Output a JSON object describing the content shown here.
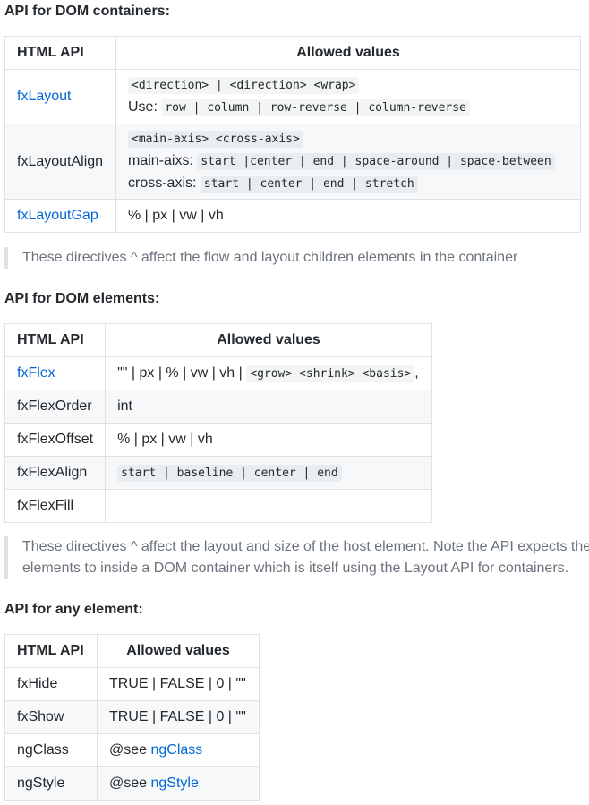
{
  "containers": {
    "title": "API for DOM containers:",
    "headers": [
      "HTML API",
      "Allowed values"
    ],
    "layout": {
      "name": "fxLayout",
      "code1": "<direction> | <direction> <wrap>",
      "use_label": "Use:",
      "code2": "row | column | row-reverse | column-reverse"
    },
    "layout_align": {
      "name": "fxLayoutAlign",
      "code1": "<main-axis> <cross-axis>",
      "main_label": "main-aixs:",
      "main_code": "start |center | end | space-around | space-between",
      "cross_label": "cross-axis:",
      "cross_code": "start | center | end | stretch"
    },
    "layout_gap": {
      "name": "fxLayoutGap",
      "value": "% | px | vw | vh"
    },
    "note": "These directives ^ affect the flow and layout children elements in the container"
  },
  "elements": {
    "title": "API for DOM elements:",
    "headers": [
      "HTML API",
      "Allowed values"
    ],
    "flex": {
      "name": "fxFlex",
      "text": "\"\" | px | % | vw | vh |",
      "code": "<grow> <shrink> <basis>",
      "suffix": ","
    },
    "flex_order": {
      "name": "fxFlexOrder",
      "value": "int"
    },
    "flex_offset": {
      "name": "fxFlexOffset",
      "value": "% | px | vw | vh"
    },
    "flex_align": {
      "name": "fxFlexAlign",
      "code": "start | baseline | center | end"
    },
    "flex_fill": {
      "name": "fxFlexFill",
      "value": ""
    },
    "note_line1": "These directives ^ affect the layout and size of the host element. Note the API expects their",
    "note_line2": "elements to inside a DOM container which is itself using the Layout API for containers."
  },
  "any": {
    "title": "API for any element:",
    "headers": [
      "HTML API",
      "Allowed values"
    ],
    "hide": {
      "name": "fxHide",
      "value": "TRUE | FALSE | 0 | \"\""
    },
    "show": {
      "name": "fxShow",
      "value": "TRUE | FALSE | 0 | \"\""
    },
    "ngclass": {
      "name": "ngClass",
      "prefix": "@see",
      "link": "ngClass"
    },
    "ngstyle": {
      "name": "ngStyle",
      "prefix": "@see",
      "link": "ngStyle"
    }
  }
}
